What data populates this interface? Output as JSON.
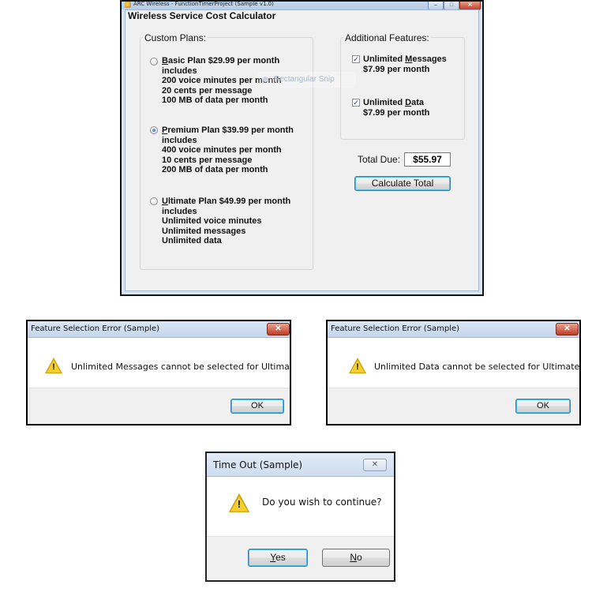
{
  "main_window": {
    "title_bar_text": "ARC Wireless - FunctionTimerProject (Sample v1.0)",
    "minimize_glyph": "–",
    "maximize_glyph": "□",
    "close_glyph": "✕",
    "app_title": "Wireless Service Cost Calculator",
    "custom_plans": {
      "group_label": "Custom Plans:",
      "plans": [
        {
          "first_line_prefix": "",
          "mnemonic": "B",
          "first_line_rest": "asic Plan $29.99 per month",
          "lines": [
            "includes",
            "200 voice minutes per month",
            "20 cents per message",
            "100 MB of data per month"
          ],
          "selected": false
        },
        {
          "first_line_prefix": "",
          "mnemonic": "P",
          "first_line_rest": "remium Plan $39.99 per month",
          "lines": [
            "includes",
            "400 voice minutes per month",
            "10 cents per message",
            "200 MB of data per month"
          ],
          "selected": true
        },
        {
          "first_line_prefix": "",
          "mnemonic": "U",
          "first_line_rest": "ltimate Plan $49.99 per month",
          "lines": [
            "includes",
            "Unlimited voice minutes",
            "Unlimited messages",
            "Unlimited data"
          ],
          "selected": false
        }
      ]
    },
    "additional_features": {
      "group_label": "Additional Features:",
      "features": [
        {
          "prefix": "Unlimited ",
          "mnemonic": "M",
          "rest": "essages",
          "price": "$7.99 per month",
          "checked": true
        },
        {
          "prefix": "Unlimited ",
          "mnemonic": "D",
          "rest": "ata",
          "price": "$7.99 per month",
          "checked": true
        }
      ]
    },
    "total_label": "Total Due:",
    "total_value": "$55.97",
    "calculate_button": "Calculate Total",
    "snip_overlay_text": "Rectangular Snip"
  },
  "dialogs": [
    {
      "title": "Feature Selection Error (Sample)",
      "message": "Unlimited Messages cannot be selected for Ultimate Plan.",
      "ok_label": "OK",
      "close_glyph": "✕"
    },
    {
      "title": "Feature Selection Error (Sample)",
      "message": "Unlimited Data cannot be selected for Ultimate Plan.",
      "ok_label": "OK",
      "close_glyph": "✕"
    }
  ],
  "timeout_dialog": {
    "title": "Time Out (Sample)",
    "message": "Do you wish to continue?",
    "yes_mnemonic": "Y",
    "yes_rest": "es",
    "no_mnemonic": "N",
    "no_rest": "o",
    "close_glyph": "✕"
  },
  "icons": [
    "app-icon",
    "warning-icon",
    "radio-icon",
    "checkbox-icon"
  ],
  "colors": {
    "title_bar": "#c4d6ec",
    "close_button": "#c03b24",
    "warning": "#f5cf2e",
    "default_button_glow": "#49b7e8"
  }
}
